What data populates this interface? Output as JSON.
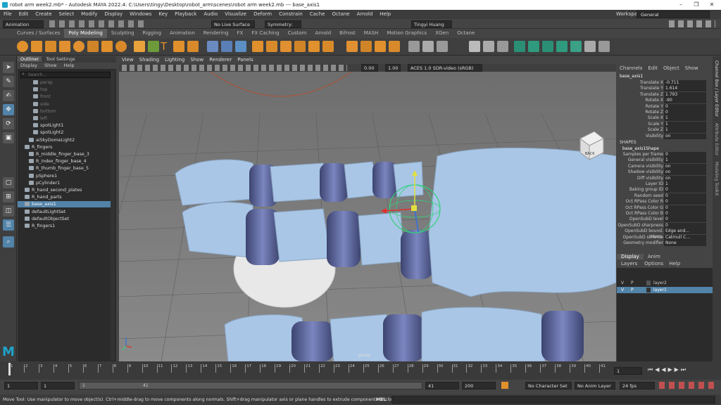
{
  "window": {
    "title": "robot arm week2.mb* - Autodesk MAYA 2022.4: C:\\Users\\tingy\\Desktop\\robot_arm\\scenes\\robot arm week2.mb  ---  base_axis1",
    "min": "–",
    "max": "❐",
    "close": "✕"
  },
  "menu": [
    "File",
    "Edit",
    "Create",
    "Select",
    "Modify",
    "Display",
    "Windows",
    "Key",
    "Playback",
    "Audio",
    "Visualize",
    "Deform",
    "Constrain",
    "Cache",
    "Octane",
    "Arnold",
    "Help"
  ],
  "workspace": {
    "label": "Workspace:",
    "value": "General"
  },
  "status": {
    "menuset": "Animation",
    "live": "No Live Surface",
    "symmetry": "Symmetry: Off",
    "user": "Tingyi Huang"
  },
  "shelf_tabs": [
    "Curves / Surfaces",
    "Poly Modeling",
    "Sculpting",
    "Rigging",
    "Animation",
    "Rendering",
    "FX",
    "FX Caching",
    "Custom",
    "Arnold",
    "Bifrost",
    "MASH",
    "Motion Graphics",
    "XGen",
    "Octane"
  ],
  "outliner": {
    "tabs": [
      "Outliner",
      "Tool Settings"
    ],
    "menus": [
      "Display",
      "Show",
      "Help"
    ],
    "search_placeholder": "Search...",
    "items": [
      {
        "label": "persp",
        "style": "cam"
      },
      {
        "label": "top",
        "style": "cam"
      },
      {
        "label": "front",
        "style": "cam"
      },
      {
        "label": "side",
        "style": "cam"
      },
      {
        "label": "bottom",
        "style": "cam"
      },
      {
        "label": "left",
        "style": "cam"
      },
      {
        "label": "spotLight1",
        "style": ""
      },
      {
        "label": "spotLight2",
        "style": ""
      },
      {
        "label": "aiSkyDomeLight2",
        "style": ""
      },
      {
        "label": "R_fingers",
        "style": ""
      },
      {
        "label": "R_middle_finger_base_3",
        "style": ""
      },
      {
        "label": "R_index_finger_base_4",
        "style": ""
      },
      {
        "label": "R_thumb_finger_base_5",
        "style": ""
      },
      {
        "label": "pSphere1",
        "style": ""
      },
      {
        "label": "pCylinder1",
        "style": ""
      },
      {
        "label": "R_hand_second_plates",
        "style": ""
      },
      {
        "label": "R_hand_parts",
        "style": ""
      },
      {
        "label": "base_axis1",
        "style": "sel"
      },
      {
        "label": "defaultLightSet",
        "style": ""
      },
      {
        "label": "defaultObjectSet",
        "style": ""
      },
      {
        "label": "R_fingers1",
        "style": ""
      }
    ]
  },
  "viewport": {
    "menus": [
      "View",
      "Shading",
      "Lighting",
      "Show",
      "Renderer",
      "Panels"
    ],
    "exposure": "0.00",
    "gamma": "1.00",
    "colorspace": "ACES 1.0 SDR-video (sRGB)",
    "cube_label": "BACK",
    "camera_label": "persp"
  },
  "channel_box": {
    "menus": [
      "Channels",
      "Edit",
      "Object",
      "Show"
    ],
    "object": "base_axis1",
    "attrs": [
      {
        "l": "Translate X",
        "v": "-0.711"
      },
      {
        "l": "Translate Y",
        "v": "1.614"
      },
      {
        "l": "Translate Z",
        "v": "1.793"
      },
      {
        "l": "Rotate X",
        "v": "-90"
      },
      {
        "l": "Rotate Y",
        "v": "0"
      },
      {
        "l": "Rotate Z",
        "v": "0"
      },
      {
        "l": "Scale X",
        "v": "1"
      },
      {
        "l": "Scale Y",
        "v": "1"
      },
      {
        "l": "Scale Z",
        "v": "1"
      },
      {
        "l": "Visibility",
        "v": "on"
      }
    ],
    "shapes_header": "SHAPES",
    "shape_name": "base_axis1Shape",
    "shape_attrs": [
      {
        "l": "Samples per frame",
        "v": "0"
      },
      {
        "l": "General visibility",
        "v": "1"
      },
      {
        "l": "Camera visibility",
        "v": "on"
      },
      {
        "l": "Shadow visibility",
        "v": "on"
      },
      {
        "l": "Diff visibility",
        "v": "on"
      },
      {
        "l": "Layer ID",
        "v": "1"
      },
      {
        "l": "Baking group ID",
        "v": "0"
      },
      {
        "l": "Random seed",
        "v": "0"
      },
      {
        "l": "Oct RPass Color R",
        "v": "0"
      },
      {
        "l": "Oct RPass Color G",
        "v": "0"
      },
      {
        "l": "Oct RPass Color B",
        "v": "0"
      },
      {
        "l": "OpenSubD level",
        "v": "0"
      },
      {
        "l": "OpenSubD sharpness",
        "v": "0"
      },
      {
        "l": "OpenSubD bound. interp.",
        "v": "Edge and..."
      },
      {
        "l": "OpenSubD scheme",
        "v": "Catmull C..."
      },
      {
        "l": "Geometry modifier",
        "v": "None"
      }
    ]
  },
  "layers": {
    "tabs": [
      "Display",
      "Anim"
    ],
    "menus": [
      "Layers",
      "Options",
      "Help"
    ],
    "rows": [
      {
        "v": "V",
        "p": "P",
        "name": "layer2"
      },
      {
        "v": "V",
        "p": "P",
        "name": "layer1"
      }
    ]
  },
  "side_tabs": [
    "Channel Box / Layer Editor",
    "Attribute Editor",
    "Modeling Toolkit"
  ],
  "timeline": {
    "ticks": [
      "1",
      "2",
      "3",
      "4",
      "5",
      "6",
      "7",
      "8",
      "9",
      "10",
      "11",
      "12",
      "13",
      "14",
      "15",
      "16",
      "17",
      "18",
      "19",
      "20",
      "21",
      "22",
      "23",
      "24",
      "25",
      "26",
      "27",
      "28",
      "29",
      "30",
      "31",
      "32",
      "33",
      "34",
      "35",
      "36",
      "37",
      "38",
      "39",
      "40",
      "41"
    ],
    "current": "1"
  },
  "range": {
    "start": "1",
    "start2": "1",
    "slider_l": "1",
    "slider_r": "41",
    "end": "41",
    "end2": "200",
    "char_set": "No Character Set",
    "anim_layer": "No Anim Layer",
    "fps": "24 fps"
  },
  "command": {
    "lang": "MEL",
    "help": "Move Tool: Use manipulator to move object(s). Ctrl+middle-drag to move components along normals. Shift+drag manipulator axis or plane handles to extrude components or clone objects. Ctrl+Shift+drag to con"
  },
  "colors": {
    "accent": "#5283a9",
    "mesh_light": "#a9c6e6",
    "mesh_dark": "#5f6aa6",
    "maya_logo": "#1fa4c9"
  }
}
